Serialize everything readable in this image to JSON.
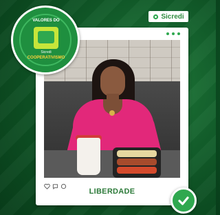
{
  "brand": {
    "name": "Sicredi"
  },
  "badge": {
    "top_text": "VALORES DO",
    "small_text": "Sicredi",
    "bottom_text": "COOPERATIVISMO"
  },
  "post": {
    "caption": "LIBERDADE"
  },
  "colors": {
    "accent": "#2fa84f",
    "caption": "#2c7a39",
    "background": "#0e5425"
  },
  "icons": [
    "heart-icon",
    "comment-icon",
    "share-icon",
    "check-icon",
    "more-dots-icon"
  ]
}
